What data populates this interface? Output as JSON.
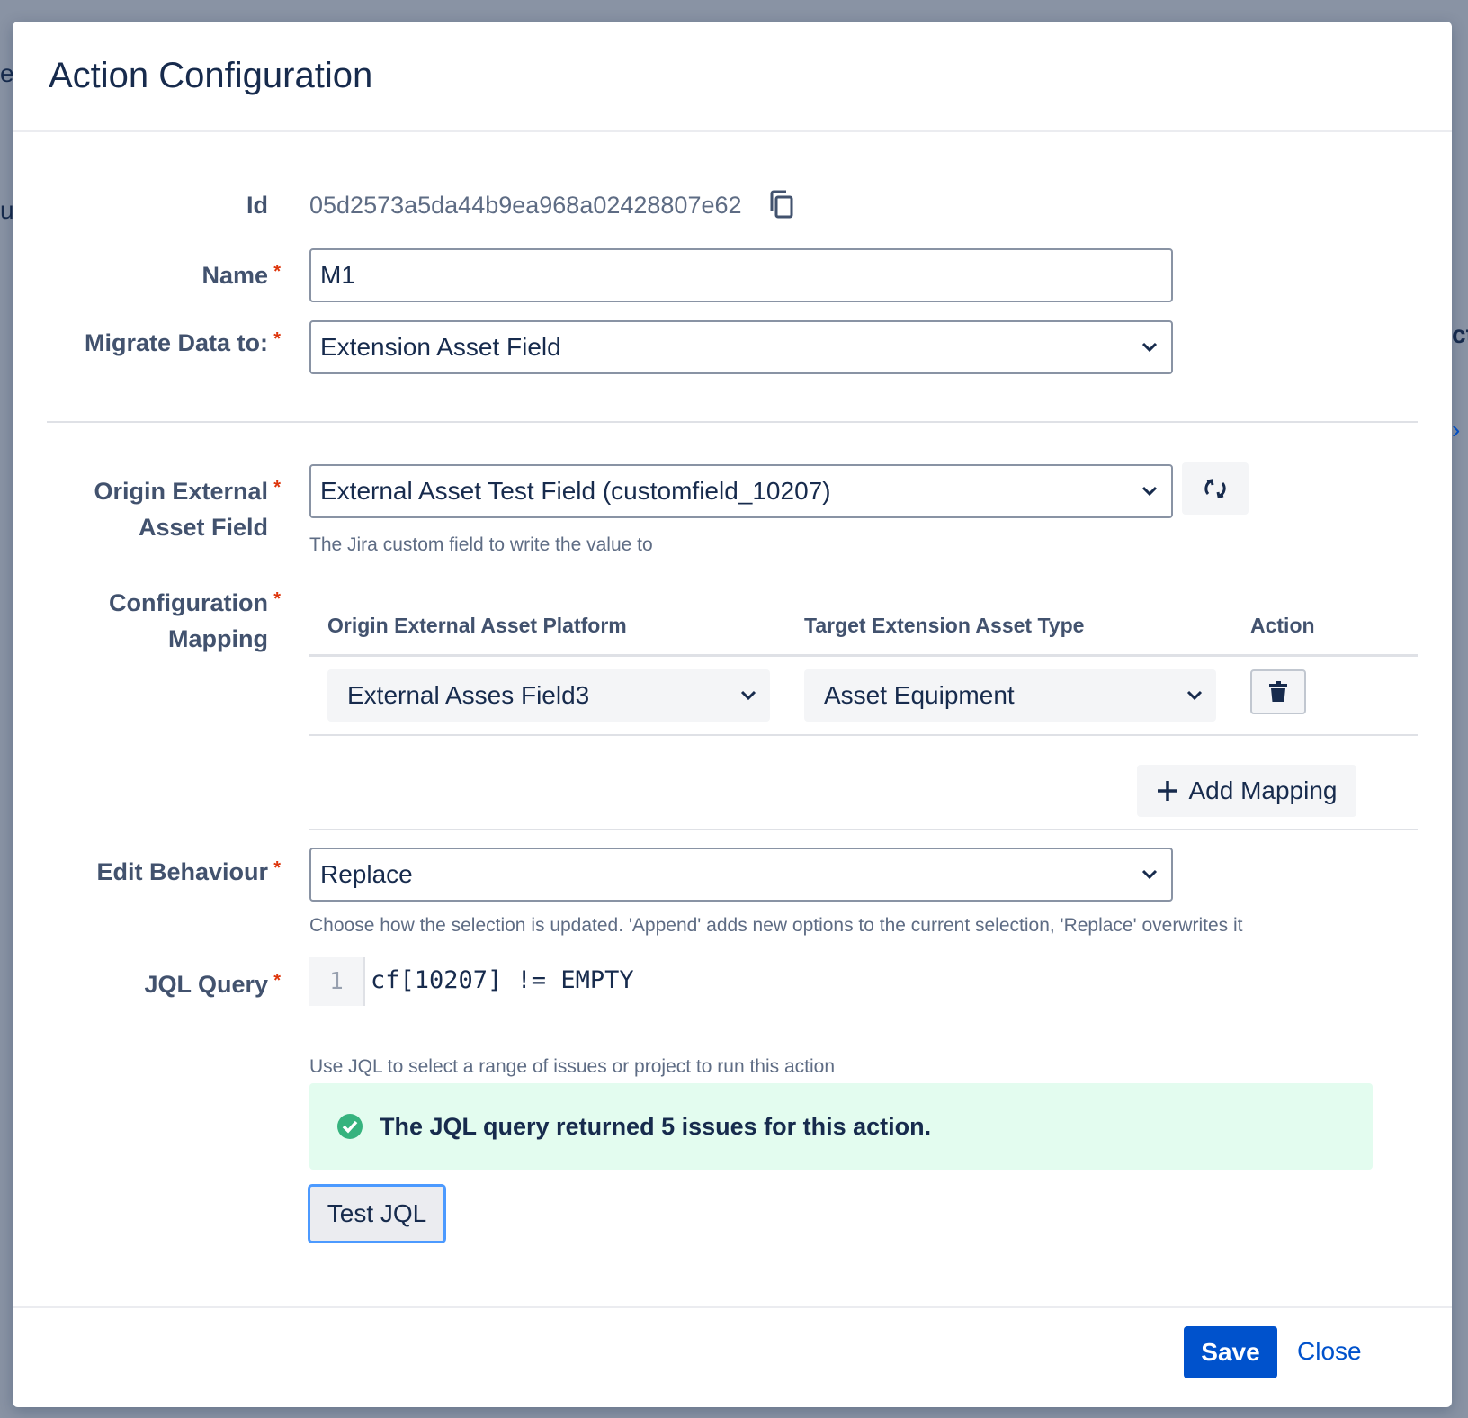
{
  "background": {
    "fragments": [
      "e",
      "u",
      "ct",
      "›"
    ]
  },
  "modal": {
    "title": "Action Configuration",
    "fields": {
      "id": {
        "label": "Id",
        "value": "05d2573a5da44b9ea968a02428807e62"
      },
      "name": {
        "label": "Name",
        "value": "M1"
      },
      "migrate_to": {
        "label": "Migrate Data to:",
        "value": "Extension Asset Field"
      },
      "origin_field": {
        "label_line1": "Origin External",
        "label_line2": "Asset Field",
        "value": "External Asset Test Field (customfield_10207)",
        "help": "The Jira custom field to write the value to"
      },
      "config_mapping": {
        "label_line1": "Configuration",
        "label_line2": "Mapping",
        "columns": [
          "Origin External Asset Platform",
          "Target Extension Asset Type",
          "Action"
        ],
        "rows": [
          {
            "origin": "External Asses Field3",
            "target": "Asset Equipment"
          }
        ],
        "add_label": "Add Mapping"
      },
      "edit_behaviour": {
        "label": "Edit Behaviour",
        "value": "Replace",
        "help": "Choose how the selection is updated. 'Append' adds new options to the current selection, 'Replace' overwrites it"
      },
      "jql": {
        "label": "JQL Query",
        "line_number": "1",
        "code": "cf[10207] != EMPTY",
        "help": "Use JQL to select a range of issues or project to run this action",
        "result": "The JQL query returned 5 issues for this action.",
        "test_label": "Test JQL"
      }
    },
    "footer": {
      "save_label": "Save",
      "close_label": "Close"
    },
    "colors": {
      "primary": "#0052cc",
      "required": "#de350b",
      "success_bg": "#e3fcef",
      "success_icon": "#36b37e",
      "focus_ring": "#4c9aff"
    }
  }
}
